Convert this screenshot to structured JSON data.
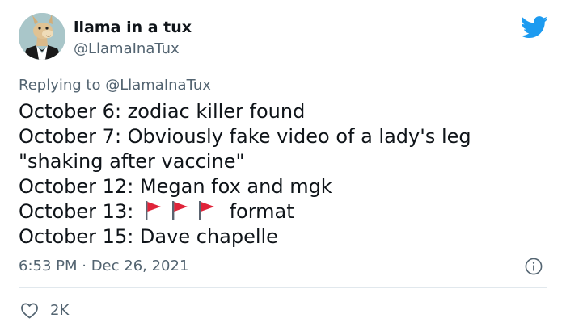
{
  "author": {
    "display_name": "llama in a tux",
    "handle": "@LlamaInaTux",
    "avatar_icon": "llama-in-tuxedo-avatar"
  },
  "brand": {
    "icon": "twitter-bird-icon",
    "color": "#1d9bf0"
  },
  "reply": {
    "prefix": "Replying to ",
    "mention": "@LlamaInaTux"
  },
  "body": {
    "lines": [
      "October 6: zodiac killer found",
      "October 7: Obviously fake video of a lady's leg",
      "\"shaking after vaccine\"",
      "October 12: Megan fox and mgk",
      "October 15: Dave chapelle"
    ],
    "flag_line": {
      "prefix": "October 13:",
      "suffix": "format",
      "emoji": "🚩",
      "emoji_count": 3
    }
  },
  "meta": {
    "timestamp": "6:53 PM · Dec 26, 2021",
    "info_icon": "info-icon"
  },
  "stats": {
    "likes": "2K",
    "like_icon": "heart-icon"
  },
  "colors": {
    "text": "#0f1419",
    "secondary": "#536471",
    "divider": "#e1e8ed",
    "flag": "#e0243a"
  }
}
